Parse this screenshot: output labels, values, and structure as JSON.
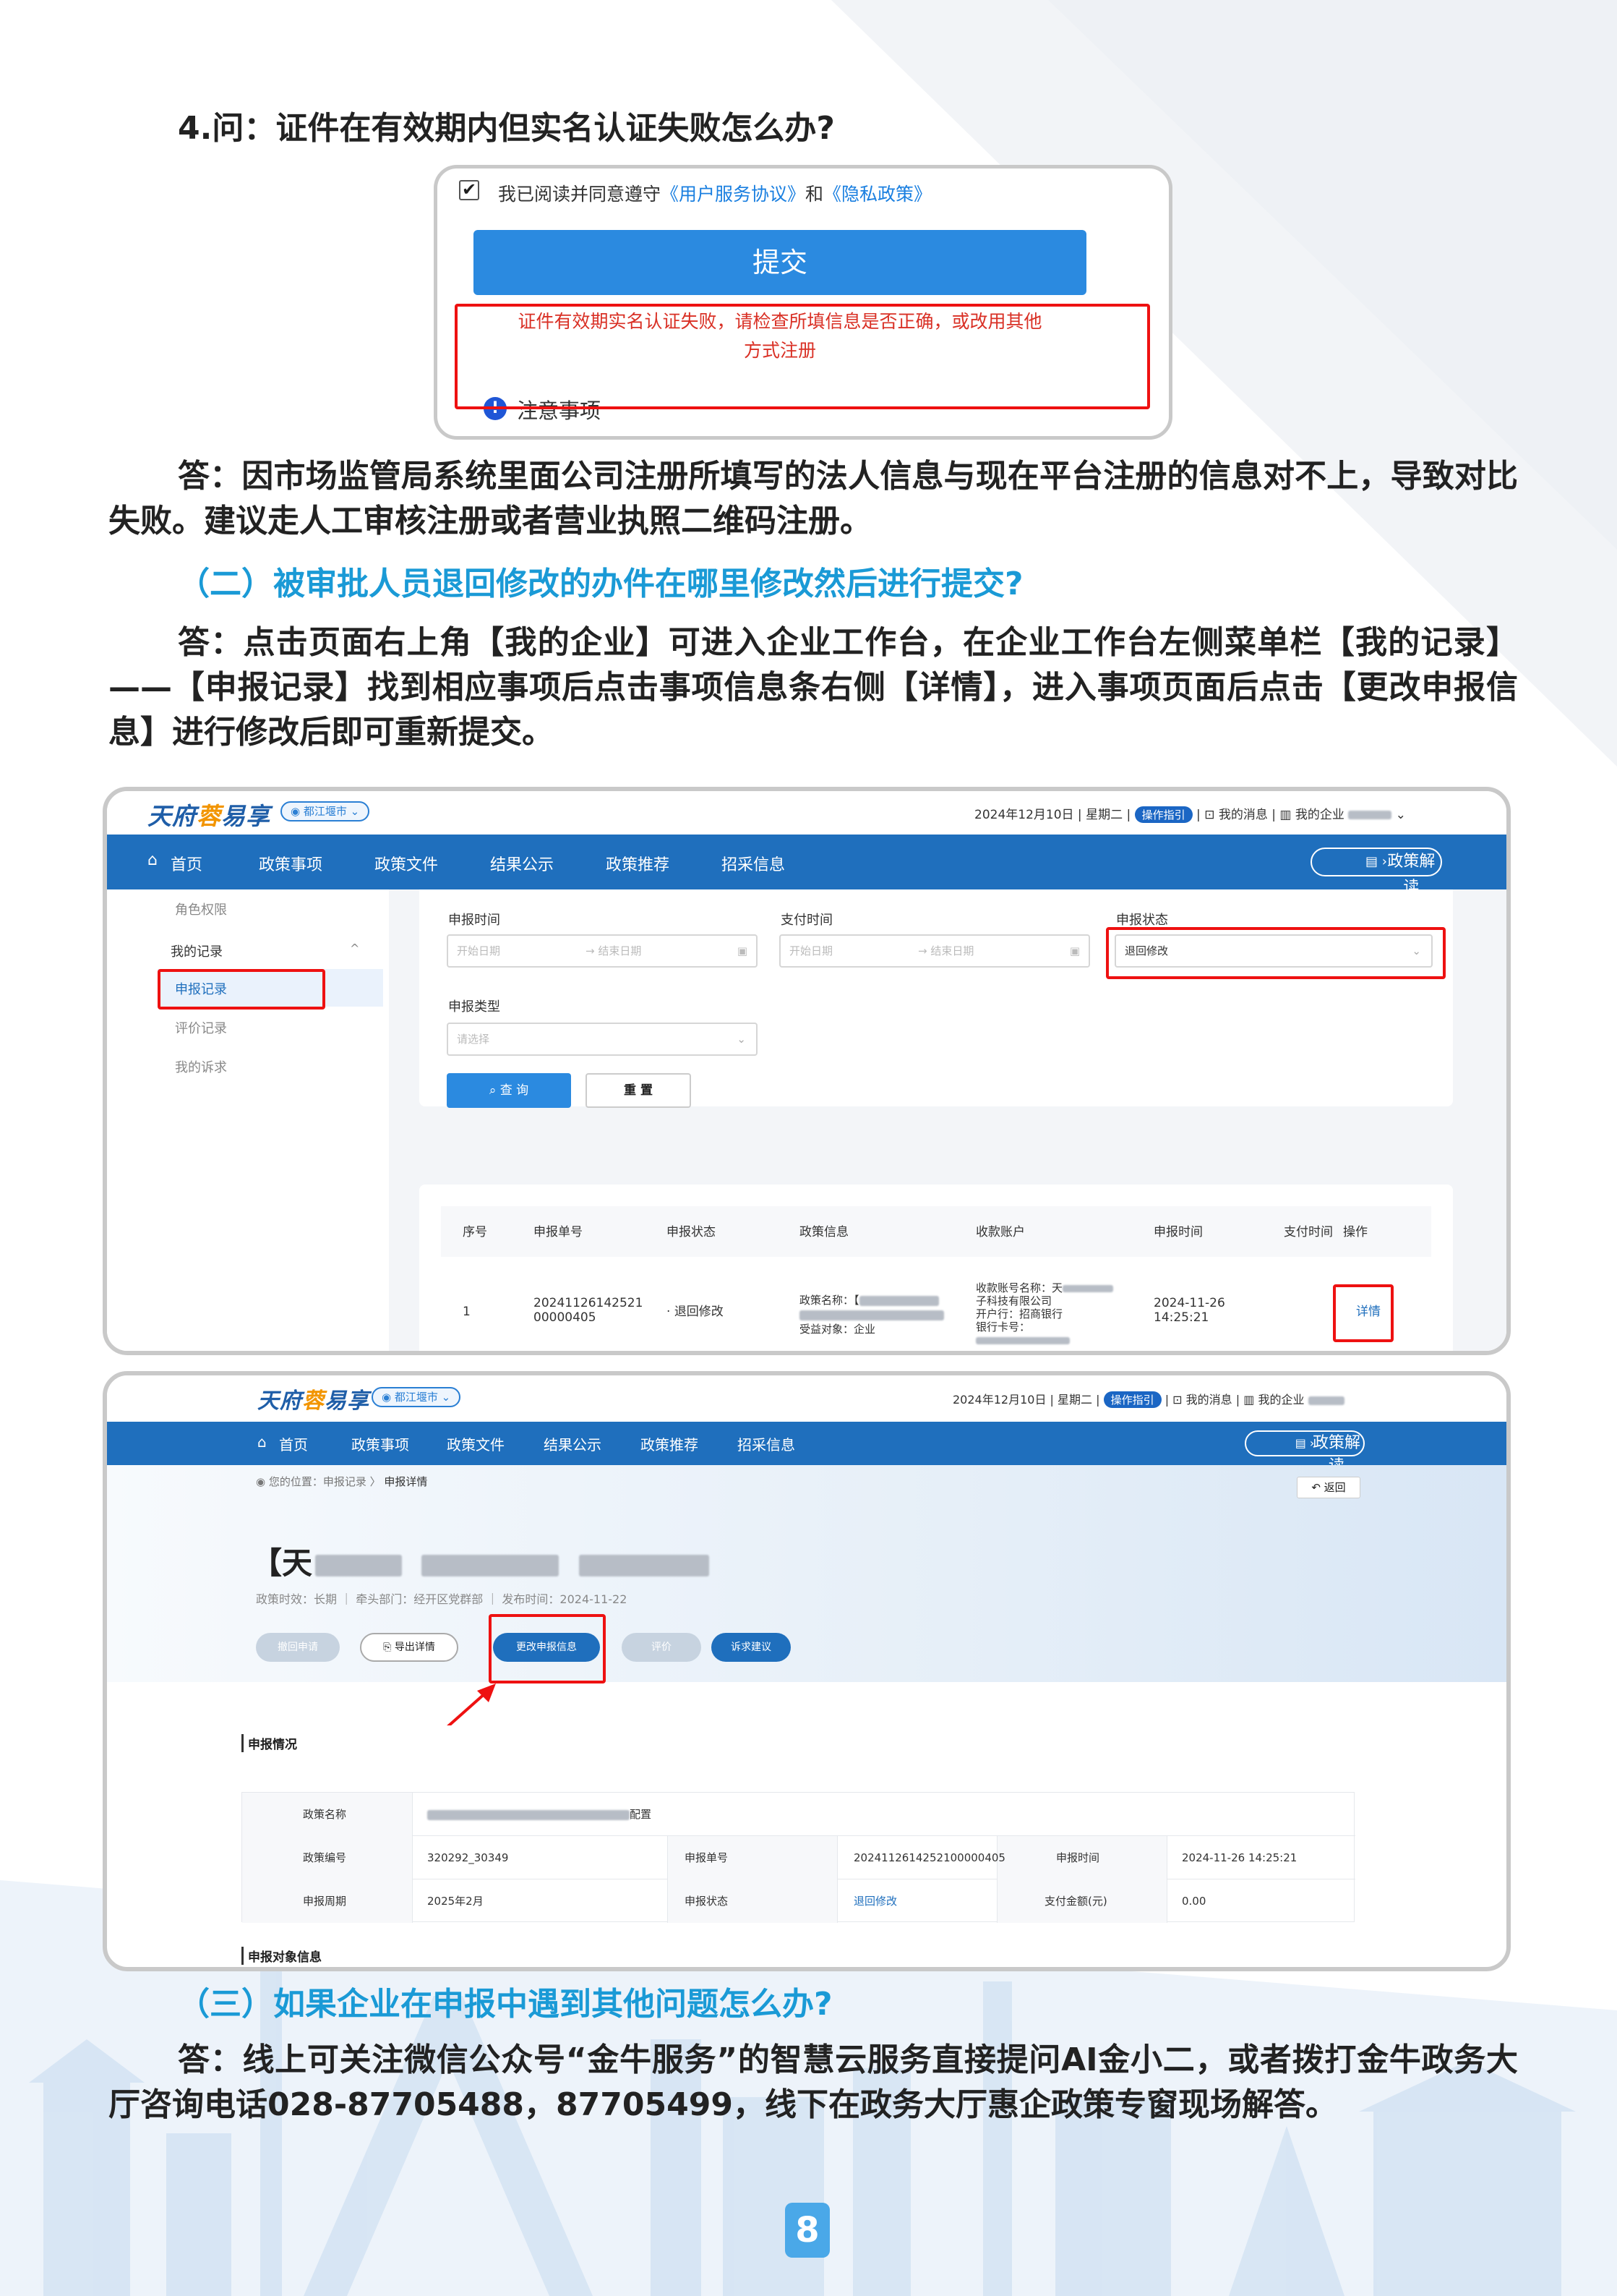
{
  "q4": {
    "title": "4.问：证件在有效期内但实名认证失败怎么办?",
    "shot": {
      "agree_prefix": "我已阅读并同意遵守",
      "agree_link1": "《用户服务协议》",
      "agree_and": "和",
      "agree_link2": "《隐私政策》",
      "submit": "提交",
      "error": "证件有效期实名认证失败，请检查所填信息是否正确，或改用其他方式注册",
      "notice": "注意事项"
    },
    "answer": "答：因市场监管局系统里面公司注册所填写的法人信息与现在平台注册的信息对不上，导致对比失败。建议走人工审核注册或者营业执照二维码注册。"
  },
  "s2": {
    "title": "（二）被审批人员退回修改的办件在哪里修改然后进行提交?",
    "answer": "答：点击页面右上角【我的企业】可进入企业工作台，在企业工作台左侧菜单栏【我的记录】——【申报记录】找到相应事项后点击事项信息条右侧【详情】，进入事项页面后点击【更改申报信息】进行修改后即可重新提交。"
  },
  "portal": {
    "brand_a": "天府",
    "brand_b": "蓉",
    "brand_c": "易享",
    "city": "都江堰市",
    "date": "2024年12月10日",
    "weekday": "星期二",
    "guide": "操作指引",
    "msg": "我的消息",
    "ent": "我的企业",
    "nav": [
      "首页",
      "政策事项",
      "政策文件",
      "结果公示",
      "政策推荐",
      "招采信息"
    ],
    "nav_btn": "政策解读"
  },
  "s1": {
    "sidebar": {
      "role": "角色权限",
      "my_records": "我的记录",
      "records": "申报记录",
      "eval": "评价记录",
      "appeal": "我的诉求"
    },
    "filter": {
      "apply_time": "申报时间",
      "pay_time": "支付时间",
      "status": "申报状态",
      "start": "开始日期",
      "end": "结束日期",
      "status_val": "退回修改",
      "type": "申报类型",
      "type_ph": "请选择",
      "query": "查 询",
      "reset": "重 置"
    },
    "table": {
      "headers": [
        "序号",
        "申报单号",
        "申报状态",
        "政策信息",
        "收款账户",
        "申报时间",
        "支付时间",
        "操作"
      ],
      "row": {
        "no": "1",
        "order": "2024112614252100000405",
        "status": "退回修改",
        "policy_name": "政策名称：【",
        "policy_target": "受益对象：企业",
        "acct_name": "收款账号名称：天",
        "acct_name2": "子科技有限公司",
        "bank": "开户行：招商银行",
        "card": "银行卡号：",
        "time": "2024-11-26 14:25:21",
        "op": "详情"
      }
    }
  },
  "s2shot": {
    "breadcrumb_prefix": "您的位置：申报记录",
    "breadcrumb_cur": "申报详情",
    "back": "返回",
    "title_prefix": "【天",
    "meta_a": "政策时效：长期",
    "meta_b": "牵头部门：经开区党群部",
    "meta_c": "发布时间：2024-11-22",
    "buttons": [
      "撤回申请",
      "导出详情",
      "更改申报信息",
      "评价",
      "诉求建议"
    ],
    "section1": "申报情况",
    "section2": "申报对象信息",
    "rows": {
      "policy_name_label": "政策名称",
      "policy_name_suffix": "配置",
      "policy_no_label": "政策编号",
      "policy_no": "320292_30349",
      "order_label": "申报单号",
      "order": "2024112614252100000405",
      "time_label": "申报时间",
      "time": "2024-11-26 14:25:21",
      "period_label": "申报周期",
      "period": "2025年2月",
      "status_label": "申报状态",
      "status": "退回修改",
      "amount_label": "支付金额(元)",
      "amount": "0.00"
    }
  },
  "s3": {
    "title": "（三）如果企业在申报中遇到其他问题怎么办?",
    "answer": "答：线上可关注微信公众号“金牛服务”的智慧云服务直接提问AI金小二，或者拨打金牛政务大厅咨询电话028-87705488，87705499，线下在政务大厅惠企政策专窗现场解答。"
  },
  "page_number": "8"
}
